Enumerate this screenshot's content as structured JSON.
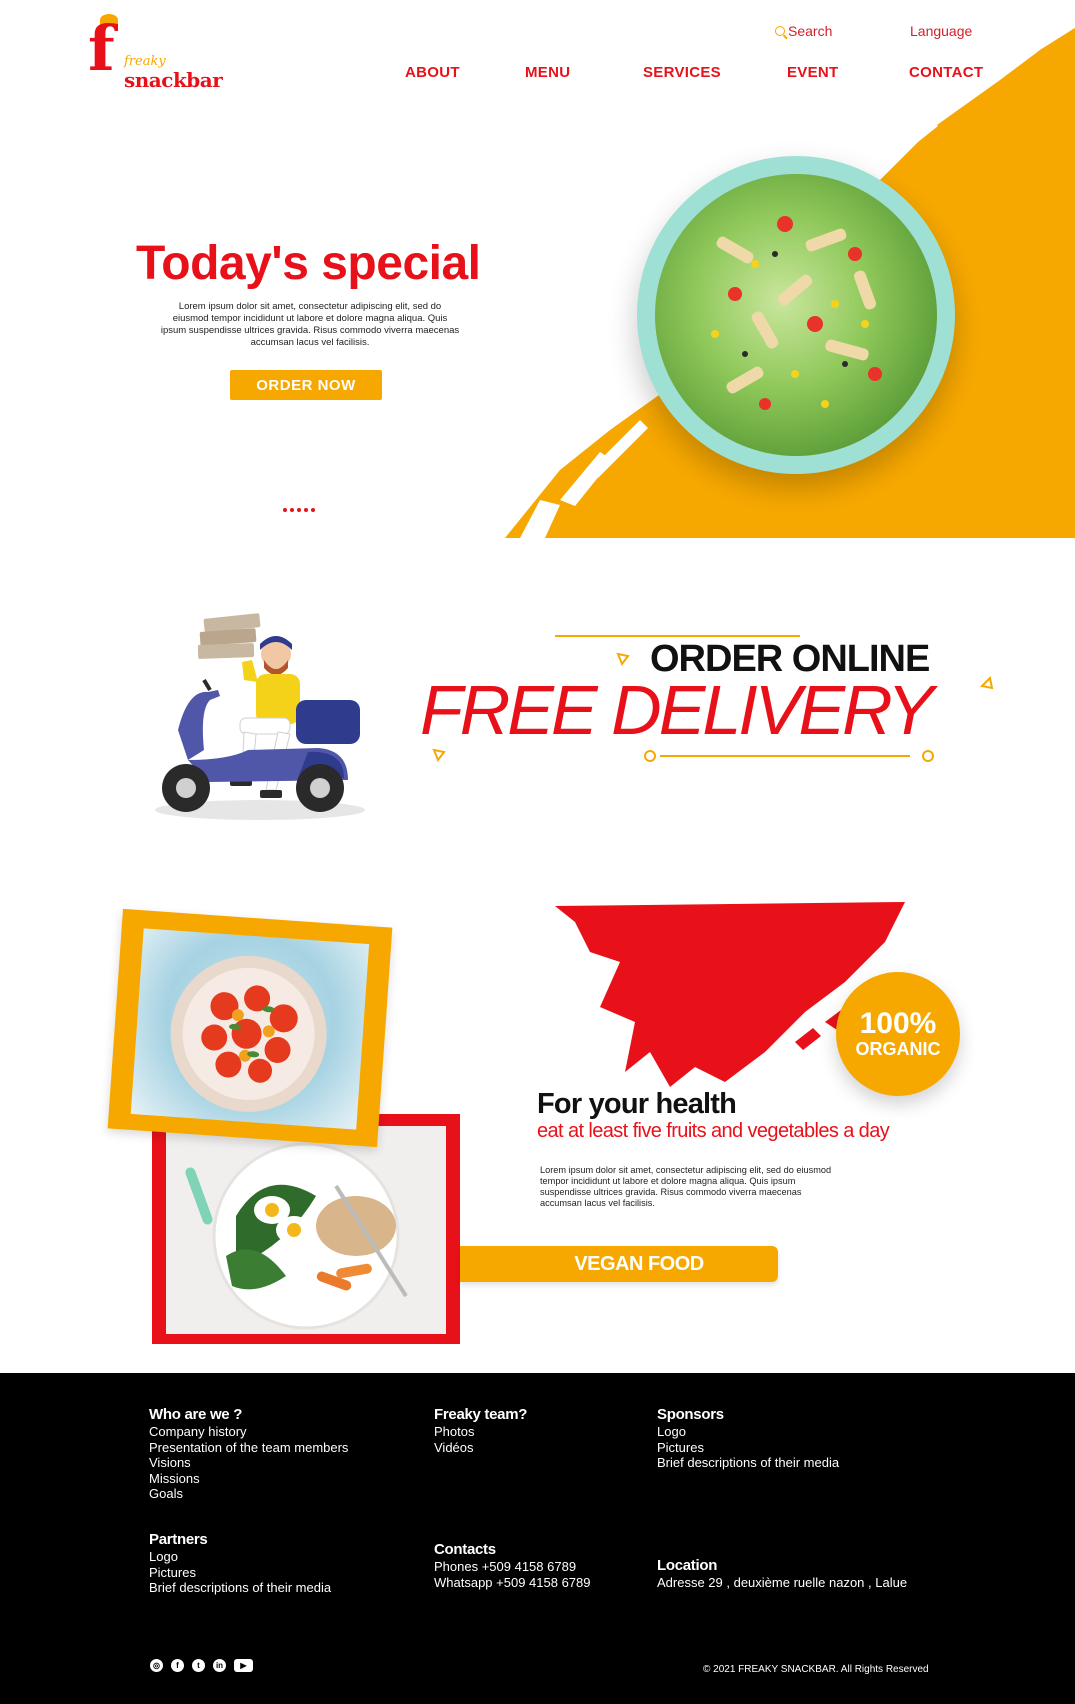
{
  "brand": {
    "top_word": "freaky",
    "main_word": "snackbar",
    "mark": "f"
  },
  "header": {
    "search_label": "Search",
    "language_label": "Language",
    "nav": [
      "ABOUT",
      "MENU",
      "SERVICES",
      "EVENT",
      "CONTACT"
    ]
  },
  "hero": {
    "title": "Today's special",
    "text": "Lorem ipsum dolor sit amet, consectetur adipiscing elit, sed do eiusmod tempor incididunt ut labore et dolore magna aliqua. Quis ipsum suspendisse ultrices gravida. Risus commodo viverra maecenas accumsan lacus vel facilisis.",
    "button": "ORDER NOW",
    "slides_count": 5
  },
  "delivery": {
    "line1": "ORDER ONLINE",
    "line2": "FREE DELIVERY"
  },
  "health": {
    "badge_pct": "100%",
    "badge_word": "ORGANIC",
    "title": "For your health",
    "subtitle": "eat at least five fruits and vegetables a day",
    "text": "Lorem ipsum dolor sit amet, consectetur adipiscing elit, sed do eiusmod tempor incididunt ut labore et dolore magna aliqua. Quis ipsum suspendisse ultrices gravida. Risus commodo viverra maecenas accumsan lacus vel facilisis.",
    "button": "VEGAN FOOD"
  },
  "footer": {
    "who": {
      "title": "Who are we ?",
      "links": [
        "Company history",
        "Presentation of the team members",
        "Visions",
        "Missions",
        "Goals"
      ]
    },
    "team": {
      "title": "Freaky team?",
      "links": [
        "Photos",
        "Vidéos"
      ]
    },
    "sponsors": {
      "title": "Sponsors",
      "links": [
        "Logo",
        "Pictures",
        "Brief descriptions of their media"
      ]
    },
    "partners": {
      "title": "Partners",
      "links": [
        "Logo",
        "Pictures",
        "Brief descriptions of their media"
      ]
    },
    "contacts": {
      "title": "Contacts",
      "links": [
        "Phones +509 4158 6789",
        "Whatsapp +509 4158 6789"
      ]
    },
    "location": {
      "title": "Location",
      "links": [
        "Adresse 29 , deuxième ruelle nazon , Lalue"
      ]
    },
    "socials": [
      "instagram-icon",
      "facebook-icon",
      "twitter-icon",
      "linkedin-icon",
      "youtube-icon"
    ],
    "copyright": "© 2021 FREAKY SNACKBAR. All Rights Reserved"
  },
  "colors": {
    "red": "#e8111a",
    "orange": "#f7a800",
    "black": "#000000"
  }
}
